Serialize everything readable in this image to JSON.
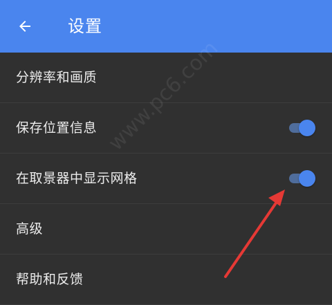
{
  "header": {
    "title": "设置",
    "background_color": "#4a85ee"
  },
  "icons": {
    "back": "arrow-left-icon"
  },
  "settings": {
    "items": [
      {
        "label": "分辨率和画质"
      },
      {
        "label": "保存位置信息",
        "toggle": "on"
      },
      {
        "label": "在取景器中显示网格",
        "toggle": "on"
      },
      {
        "label": "高级"
      },
      {
        "label": "帮助和反馈"
      }
    ]
  },
  "watermark": {
    "text": "www.pc6.com"
  },
  "colors": {
    "accent": "#4a85ee",
    "background": "#303030",
    "annotation_arrow": "#e53935"
  }
}
